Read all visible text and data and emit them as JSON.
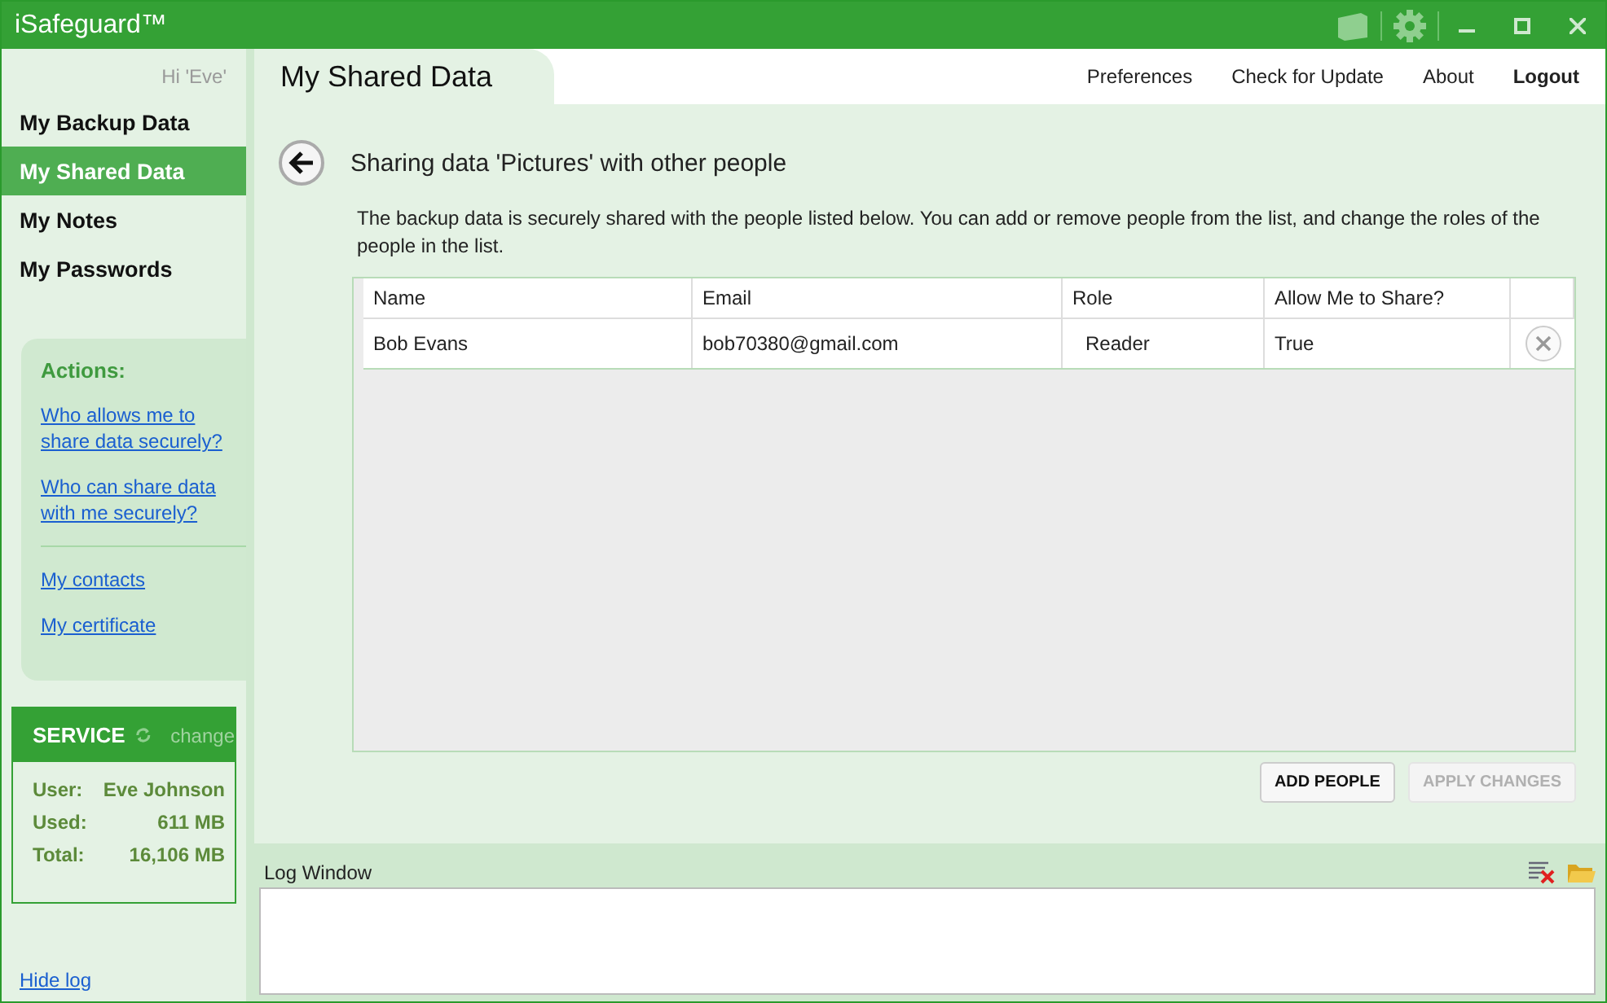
{
  "window": {
    "title": "iSafeguard™"
  },
  "sidebar": {
    "greeting": "Hi 'Eve'",
    "items": [
      {
        "label": "My Backup Data",
        "selected": false
      },
      {
        "label": "My Shared Data",
        "selected": true
      },
      {
        "label": "My Notes",
        "selected": false
      },
      {
        "label": "My Passwords",
        "selected": false
      }
    ],
    "actions": {
      "title": "Actions:",
      "links": [
        "Who allows me to share data securely?",
        "Who can share data with me securely?"
      ],
      "more_links": [
        "My contacts",
        "My certificate"
      ]
    },
    "service": {
      "title": "SERVICE",
      "change": "change",
      "rows": [
        {
          "label": "User:",
          "value": "Eve Johnson"
        },
        {
          "label": "Used:",
          "value": "611 MB"
        },
        {
          "label": "Total:",
          "value": "16,106 MB"
        }
      ]
    },
    "hide_log": "Hide log"
  },
  "page_tab": "My Shared Data",
  "top_links": [
    {
      "label": "Preferences",
      "bold": false
    },
    {
      "label": "Check for Update",
      "bold": false
    },
    {
      "label": "About",
      "bold": false
    },
    {
      "label": "Logout",
      "bold": true
    }
  ],
  "heading": "Sharing data 'Pictures' with other people",
  "description": "The backup data is securely shared with the people listed below. You can add or remove people from the list, and change the roles of the people in the list.",
  "table": {
    "columns": [
      "Name",
      "Email",
      "Role",
      "Allow Me to Share?"
    ],
    "rows": [
      {
        "cells": [
          "Bob Evans",
          "bob70380@gmail.com",
          "Reader",
          "True"
        ]
      }
    ]
  },
  "buttons": [
    {
      "label": "ADD PEOPLE",
      "disabled": false
    },
    {
      "label": "APPLY CHANGES",
      "disabled": true
    }
  ],
  "log": {
    "title": "Log Window"
  }
}
